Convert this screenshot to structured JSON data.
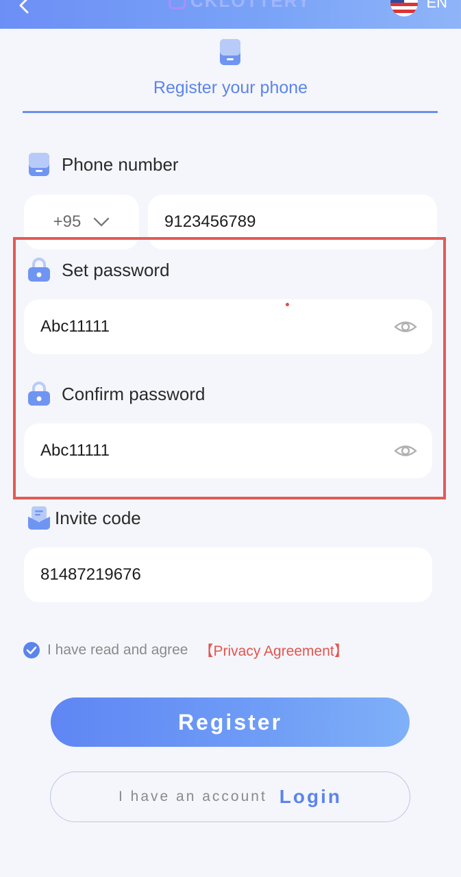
{
  "header": {
    "brand": "CKLOTTERY",
    "language": "EN"
  },
  "tab": {
    "title": "Register your phone"
  },
  "phone": {
    "label": "Phone number",
    "country_code": "+95",
    "value": "9123456789"
  },
  "password": {
    "label": "Set password",
    "value": "Abc11111"
  },
  "confirm_password": {
    "label": "Confirm password",
    "value": "Abc11111"
  },
  "invite": {
    "label": "Invite code",
    "value": "81487219676"
  },
  "agreement": {
    "text": "I have read and agree",
    "link": "【Privacy Agreement】",
    "checked": true
  },
  "actions": {
    "register_label": "Register",
    "have_account_text": "I have an account",
    "login_label": "Login"
  },
  "colors": {
    "accent": "#5b84ec",
    "highlight": "#e35a55",
    "link_red": "#e2554f"
  }
}
